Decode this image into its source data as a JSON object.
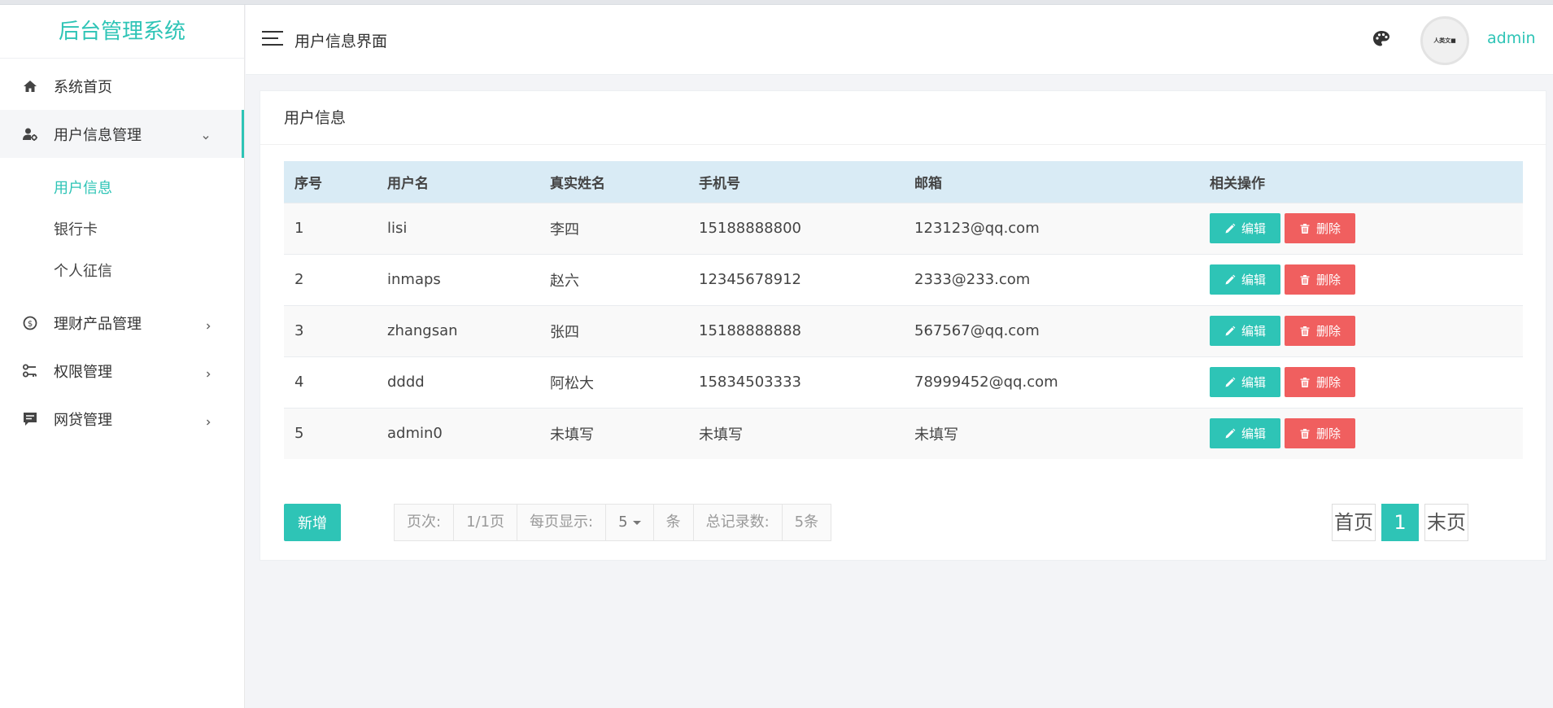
{
  "app": {
    "brand": "后台管理系统"
  },
  "sidebar": {
    "items": [
      {
        "label": "系统首页",
        "icon": "home-icon"
      },
      {
        "label": "用户信息管理",
        "icon": "user-settings-icon",
        "expanded": true,
        "children": [
          {
            "label": "用户信息",
            "active": true
          },
          {
            "label": "银行卡"
          },
          {
            "label": "个人征信"
          }
        ]
      },
      {
        "label": "理财产品管理",
        "icon": "finance-icon"
      },
      {
        "label": "权限管理",
        "icon": "permission-key-icon"
      },
      {
        "label": "网贷管理",
        "icon": "loan-icon"
      }
    ]
  },
  "header": {
    "title": "用户信息界面",
    "avatar_text": "人类文■",
    "username": "admin"
  },
  "card": {
    "title": "用户信息",
    "columns": [
      "序号",
      "用户名",
      "真实姓名",
      "手机号",
      "邮箱",
      "相关操作"
    ],
    "rows": [
      [
        "1",
        "lisi",
        "李四",
        "15188888800",
        "123123@qq.com"
      ],
      [
        "2",
        "inmaps",
        "赵六",
        "12345678912",
        "2333@233.com"
      ],
      [
        "3",
        "zhangsan",
        "张四",
        "15188888888",
        "567567@qq.com"
      ],
      [
        "4",
        "dddd",
        "阿松大",
        "15834503333",
        "78999452@qq.com"
      ],
      [
        "5",
        "admin0",
        "未填写",
        "未填写",
        "未填写"
      ]
    ],
    "edit_label": "编辑",
    "delete_label": "删除",
    "add_label": "新增"
  },
  "pager": {
    "page_label": "页次:",
    "page_value": "1/1页",
    "per_page_label": "每页显示:",
    "per_page_value": "5",
    "per_page_unit": "条",
    "total_label": "总记录数:",
    "total_value": "5条",
    "first": "首页",
    "current": "1",
    "last": "末页"
  },
  "colors": {
    "accent": "#2ec4b6",
    "danger": "#f05f5f",
    "table_header": "#d9ebf5"
  }
}
